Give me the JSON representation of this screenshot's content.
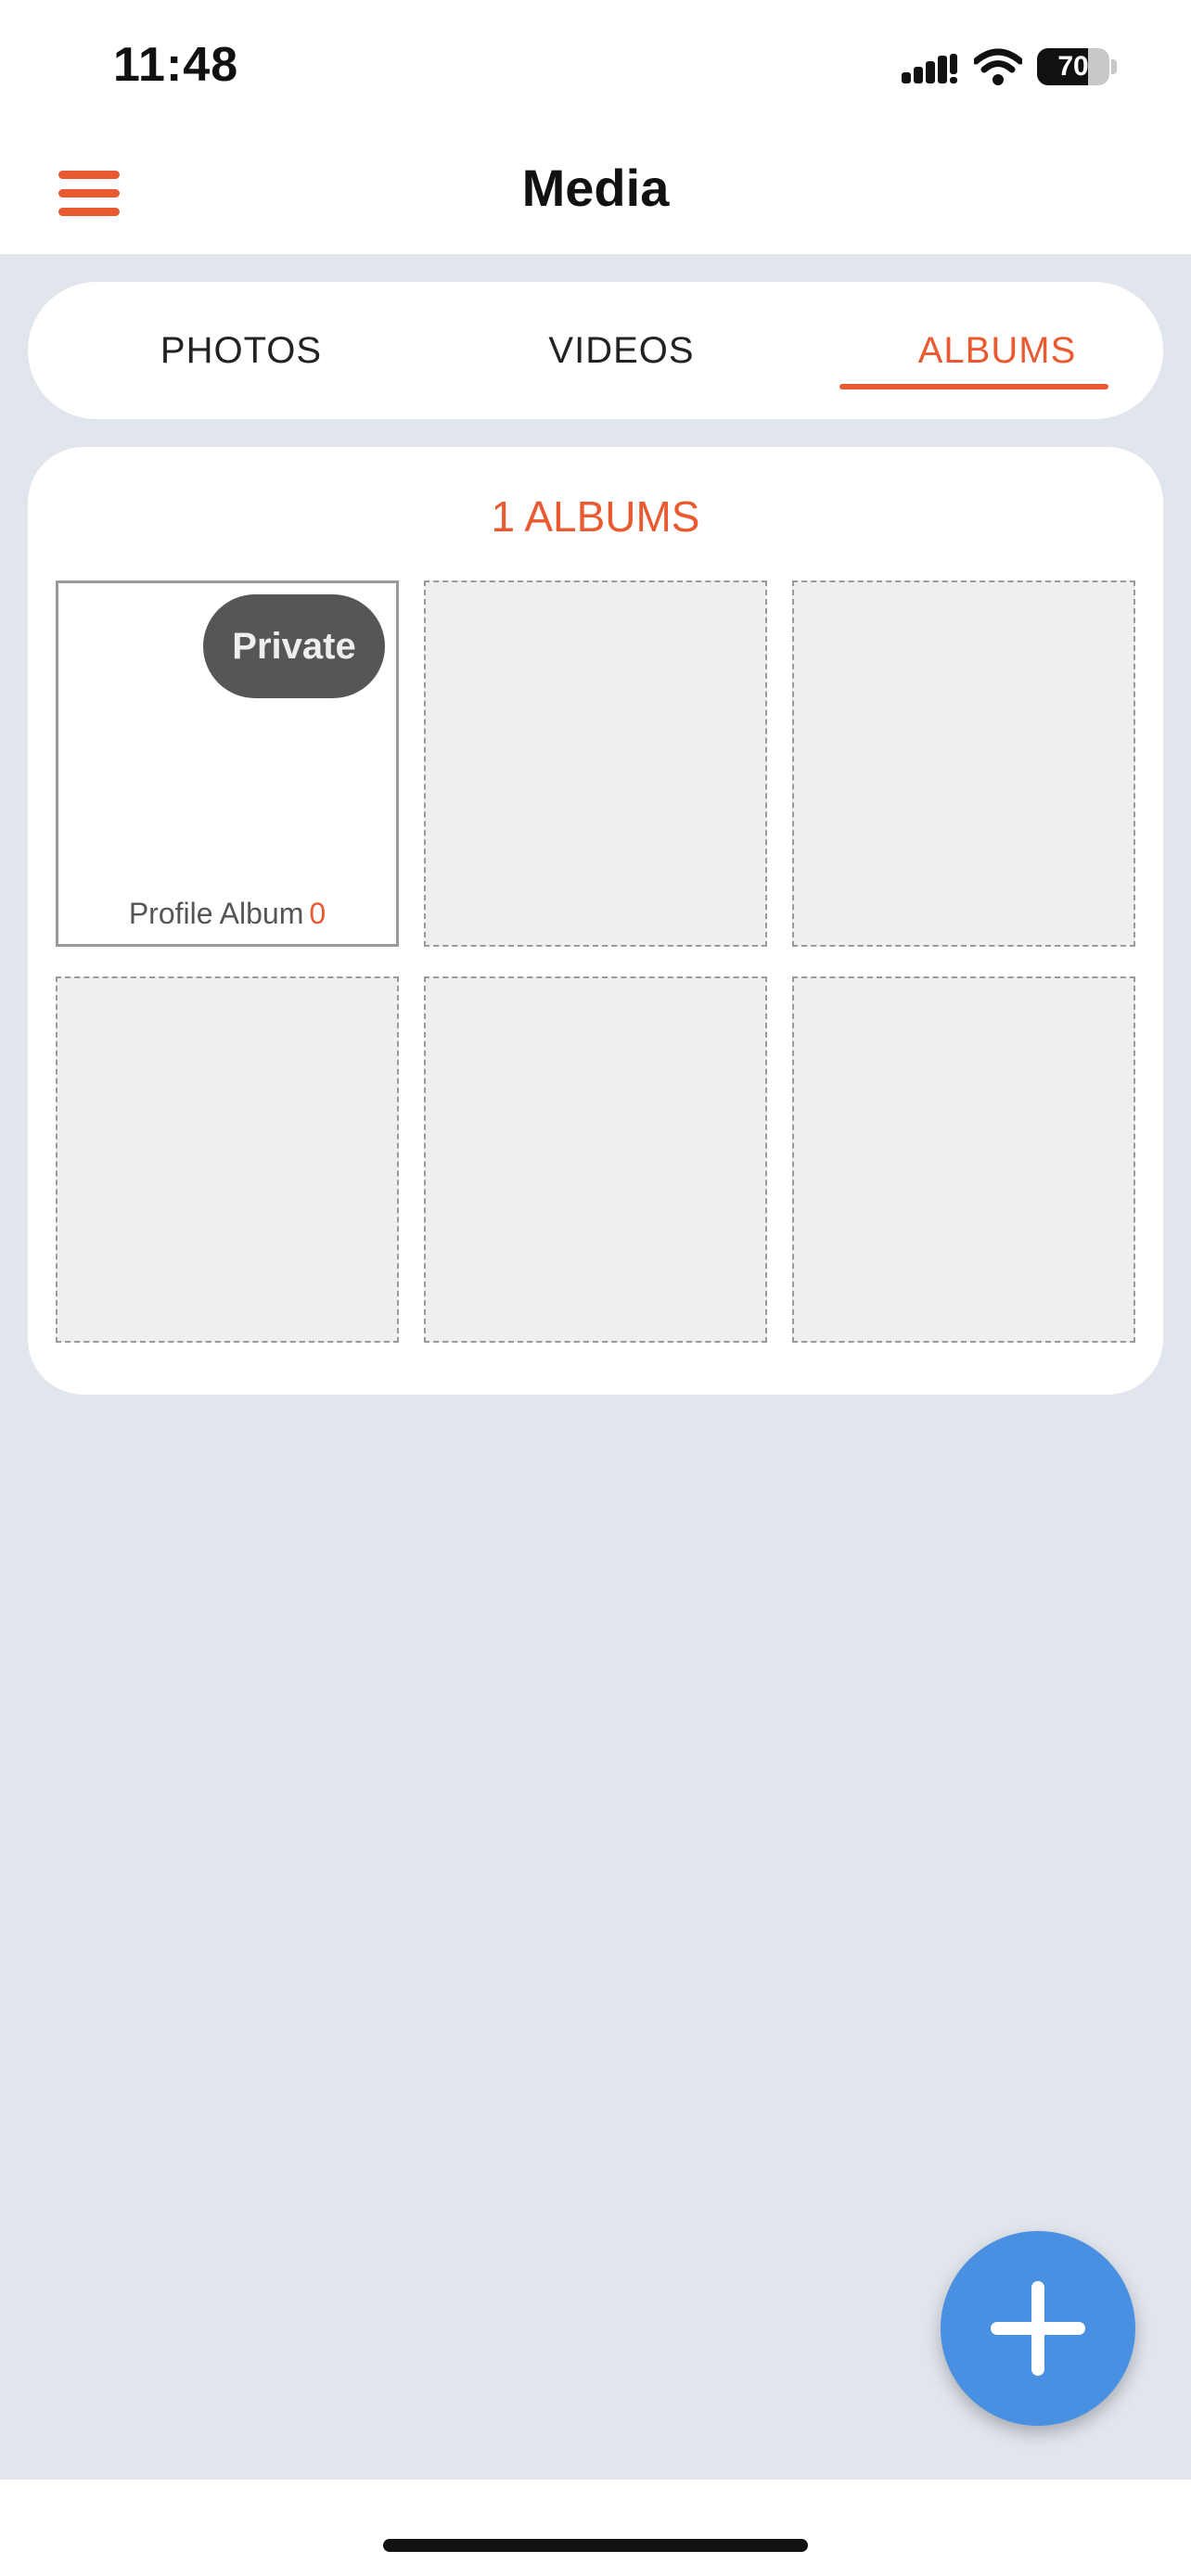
{
  "status_bar": {
    "time": "11:48",
    "battery_level": "70",
    "icons": [
      "signal-icon",
      "wifi-icon",
      "battery-icon"
    ]
  },
  "header": {
    "title": "Media",
    "menu_icon": "hamburger-menu-icon"
  },
  "tabs": [
    {
      "label": "PHOTOS",
      "active": false
    },
    {
      "label": "VIDEOS",
      "active": false
    },
    {
      "label": "ALBUMS",
      "active": true
    }
  ],
  "albums": {
    "count_label": "1 ALBUMS",
    "items": [
      {
        "name": "Profile Album",
        "count": "0",
        "badge": "Private"
      }
    ],
    "empty_slots": 5
  },
  "fab": {
    "icon": "plus-icon"
  },
  "colors": {
    "accent": "#ea5a31",
    "fab": "#4a90e2",
    "background": "#e1e6ed"
  }
}
